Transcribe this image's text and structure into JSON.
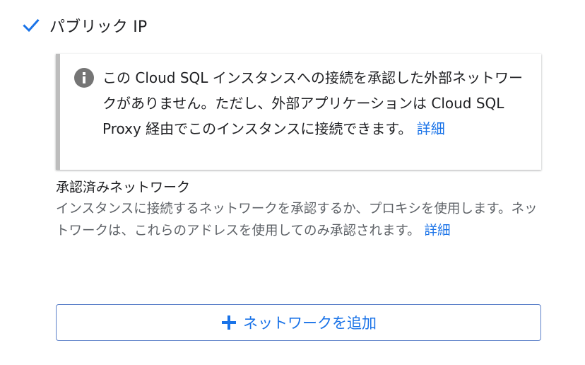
{
  "public_ip": {
    "label": "パブリック IP",
    "checked": true
  },
  "info": {
    "icon": "info-icon",
    "message": "この Cloud SQL インスタンスへの接続を承認した外部ネットワークがありません。ただし、外部アプリケーションは Cloud SQL Proxy 経由でこのインスタンスに接続できます。",
    "link_label": "詳細"
  },
  "authorized_networks": {
    "title": "承認済みネットワーク",
    "description": "インスタンスに接続するネットワークを承認するか、プロキシを使用します。ネットワークは、これらのアドレスを使用してのみ承認されます。",
    "link_label": "詳細"
  },
  "add_network_button": {
    "icon": "plus-icon",
    "label": "ネットワークを追加"
  },
  "colors": {
    "accent": "#1a73e8",
    "text": "#202124",
    "secondary_text": "#5f6368",
    "info_border": "#bdbdbd"
  }
}
